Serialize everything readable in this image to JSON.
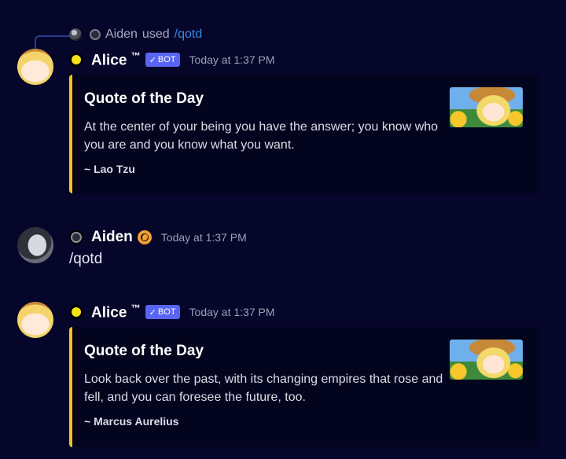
{
  "reply": {
    "user": "Aiden",
    "verb": "used",
    "command": "/qotd"
  },
  "messages": [
    {
      "author": "Alice",
      "trademark": "™",
      "bot_tag": "BOT",
      "check": "✓",
      "timestamp": "Today at 1:37 PM",
      "embed": {
        "title": "Quote of the Day",
        "description": "At the center of your being you have the answer; you know who you are and you know what you want.",
        "footer": "~ Lao Tzu"
      }
    },
    {
      "author": "Aiden",
      "timestamp": "Today at 1:37 PM",
      "content": "/qotd"
    },
    {
      "author": "Alice",
      "trademark": "™",
      "bot_tag": "BOT",
      "check": "✓",
      "timestamp": "Today at 1:37 PM",
      "embed": {
        "title": "Quote of the Day",
        "description": "Look back over the past, with its changing empires that rose and fell, and you can foresee the future, too.",
        "footer": "~ Marcus Aurelius"
      }
    }
  ],
  "colors": {
    "background": "#05062a",
    "embed_accent": "#f2c418",
    "bot_tag": "#5865f2",
    "link": "#3a8ae0",
    "status_online": "#f5e31a"
  }
}
